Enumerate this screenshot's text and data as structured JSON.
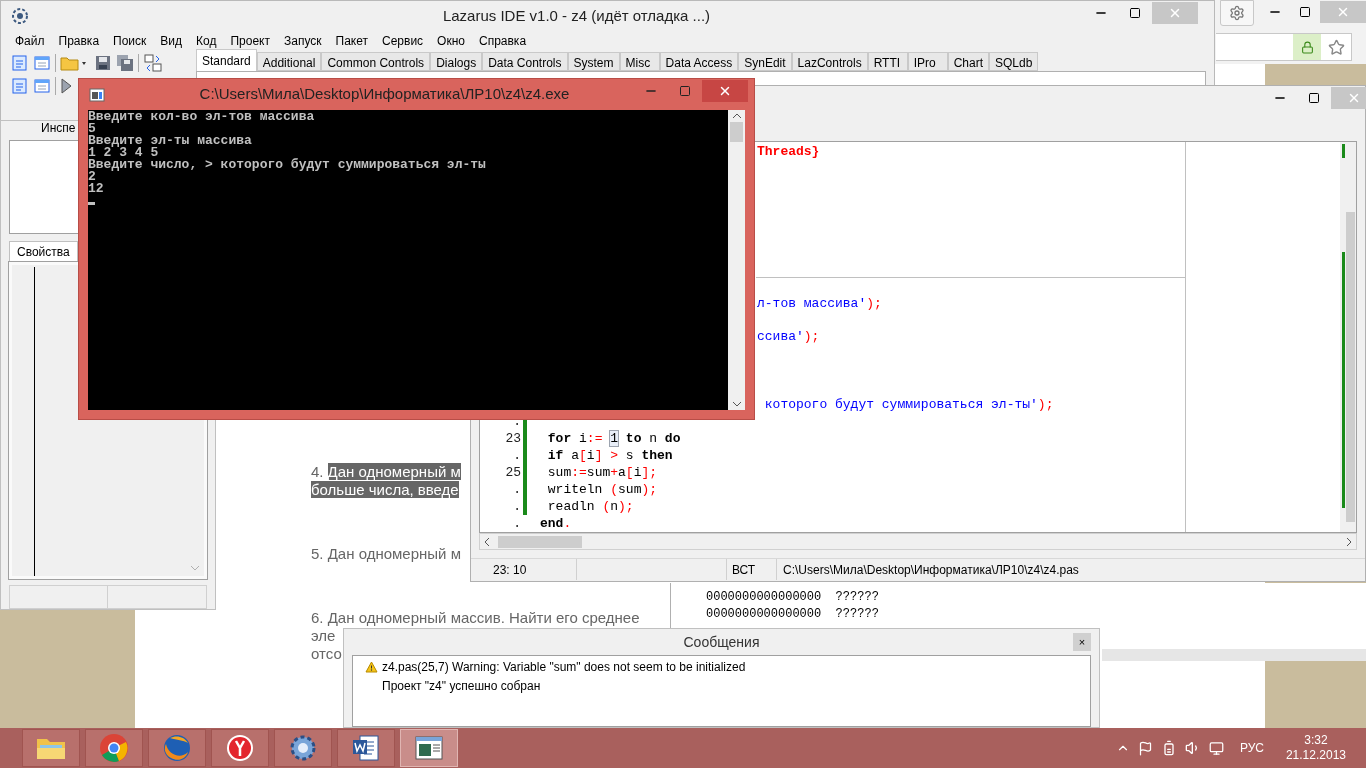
{
  "lazarus_window": {
    "title": "Lazarus IDE v1.0 - z4 (идёт отладка ...)",
    "menu": [
      "Файл",
      "Правка",
      "Поиск",
      "Вид",
      "Код",
      "Проект",
      "Запуск",
      "Пакет",
      "Сервис",
      "Окно",
      "Справка"
    ],
    "palette_tabs": [
      {
        "label": "Standard",
        "selected": true
      },
      {
        "label": "Additional",
        "selected": false
      },
      {
        "label": "Common Controls",
        "selected": false
      },
      {
        "label": "Dialogs",
        "selected": false
      },
      {
        "label": "Data Controls",
        "selected": false
      },
      {
        "label": "System",
        "selected": false
      },
      {
        "label": "Misc",
        "selected": false
      },
      {
        "label": "Data Access",
        "selected": false
      },
      {
        "label": "SynEdit",
        "selected": false
      },
      {
        "label": "LazControls",
        "selected": false
      },
      {
        "label": "RTTI",
        "selected": false
      },
      {
        "label": "IPro",
        "selected": false
      },
      {
        "label": "Chart",
        "selected": false
      },
      {
        "label": "SQLdb",
        "selected": false
      }
    ]
  },
  "object_inspector": {
    "title": "Инспе",
    "tabs": [
      {
        "label": "Свойства",
        "selected": true
      }
    ]
  },
  "browser_page": {
    "paragraphs": [
      {
        "lines": [
          [
            {
              "text": "4.",
              "highlighted": false
            },
            {
              "text": "Дан одномерный м",
              "highlighted": true
            }
          ],
          [
            {
              "text": "больше числа, введе",
              "highlighted": true
            }
          ]
        ]
      },
      {
        "lines": [
          [
            {
              "text": "5. Дан одномерный м",
              "highlighted": false
            }
          ]
        ]
      },
      {
        "lines": [
          [
            {
              "text": "6. Дан одномерный массив. Найти его среднее",
              "highlighted": false
            }
          ],
          [
            {
              "text": "эле",
              "highlighted": false
            }
          ],
          [
            {
              "text": "отсо",
              "highlighted": false
            }
          ]
        ]
      }
    ]
  },
  "source_editor": {
    "rows": [
      {
        "kind": "clipped",
        "tokens": [
          {
            "text": "Threads}",
            "kind": "dir"
          }
        ]
      },
      {
        "kind": "covered"
      },
      {
        "kind": "covered"
      },
      {
        "kind": "covered"
      },
      {
        "kind": "covered"
      },
      {
        "kind": "covered"
      },
      {
        "kind": "covered"
      },
      {
        "kind": "covered"
      },
      {
        "kind": "covered"
      },
      {
        "kind": "clipped",
        "tokens": [
          {
            "text": "л-тов массива'",
            "kind": "str"
          },
          {
            "text": ");",
            "kind": "sym"
          }
        ]
      },
      {
        "kind": "covered"
      },
      {
        "kind": "clipped",
        "tokens": [
          {
            "text": "ссива'",
            "kind": "str"
          },
          {
            "text": ");",
            "kind": "sym"
          }
        ]
      },
      {
        "kind": "covered"
      },
      {
        "kind": "covered"
      },
      {
        "kind": "covered"
      },
      {
        "kind": "clipped",
        "tokens": [
          {
            "text": " которого будут суммироваться эл-ты'",
            "kind": "str"
          },
          {
            "text": ");",
            "kind": "sym"
          }
        ]
      },
      {
        "kind": "gutter_only",
        "gutter": ".",
        "modified": true
      },
      {
        "kind": "full",
        "gutter": "23",
        "modified": true,
        "tokens": [
          {
            "text": " for",
            "kind": "kw"
          },
          {
            "text": " i",
            "kind": "id"
          },
          {
            "text": ":= ",
            "kind": "sym"
          },
          {
            "text": "1",
            "kind": "hl"
          },
          {
            "text": " to",
            "kind": "kw"
          },
          {
            "text": " n ",
            "kind": "id"
          },
          {
            "text": "do",
            "kind": "kw"
          }
        ]
      },
      {
        "kind": "full",
        "gutter": ".",
        "modified": true,
        "tokens": [
          {
            "text": " if",
            "kind": "kw"
          },
          {
            "text": " a",
            "kind": "id"
          },
          {
            "text": "[",
            "kind": "sym"
          },
          {
            "text": "i",
            "kind": "id"
          },
          {
            "text": "] >",
            "kind": "sym"
          },
          {
            "text": " s ",
            "kind": "id"
          },
          {
            "text": "then",
            "kind": "kw"
          }
        ]
      },
      {
        "kind": "full",
        "gutter": "25",
        "modified": true,
        "tokens": [
          {
            "text": " sum",
            "kind": "id"
          },
          {
            "text": ":=",
            "kind": "sym"
          },
          {
            "text": "sum",
            "kind": "id"
          },
          {
            "text": "+",
            "kind": "sym"
          },
          {
            "text": "a",
            "kind": "id"
          },
          {
            "text": "[",
            "kind": "sym"
          },
          {
            "text": "i",
            "kind": "id"
          },
          {
            "text": "];",
            "kind": "sym"
          }
        ]
      },
      {
        "kind": "full",
        "gutter": ".",
        "modified": true,
        "tokens": [
          {
            "text": " writeln ",
            "kind": "id"
          },
          {
            "text": "(",
            "kind": "sym"
          },
          {
            "text": "sum",
            "kind": "id"
          },
          {
            "text": ");",
            "kind": "sym"
          }
        ]
      },
      {
        "kind": "full",
        "gutter": ".",
        "modified": true,
        "tokens": [
          {
            "text": " readln ",
            "kind": "id"
          },
          {
            "text": "(",
            "kind": "sym"
          },
          {
            "text": "n",
            "kind": "id"
          },
          {
            "text": ");",
            "kind": "sym"
          }
        ]
      },
      {
        "kind": "full",
        "gutter": ".",
        "modified": false,
        "tokens": [
          {
            "text": "end",
            "kind": "kw"
          },
          {
            "text": ".",
            "kind": "sym"
          }
        ]
      }
    ],
    "status_bar": {
      "position": "23: 10",
      "mode": "ВСТ",
      "path": "C:\\Users\\Мила\\Desktop\\Информатика\\ЛР10\\z4\\z4.pas"
    }
  },
  "memory_window": {
    "lines": [
      "0000000000000000  ??????",
      "0000000000000000  ??????"
    ]
  },
  "console_window": {
    "title": "C:\\Users\\Мила\\Desktop\\Информатика\\ЛР10\\z4\\z4.exe",
    "lines": [
      "Введите кол-во эл-тов массива",
      "5",
      "Введите эл-ты массива",
      "1 2 3 4 5",
      "Введите число, > которого будут суммироваться эл-ты",
      "2",
      "12"
    ]
  },
  "messages_window": {
    "title": "Сообщения",
    "close": "×",
    "items": [
      {
        "kind": "warning",
        "text": "z4.pas(25,7) Warning: Variable \"sum\" does not seem to be initialized"
      },
      {
        "kind": "info",
        "text": "Проект \"z4\" успешно собран"
      }
    ]
  },
  "taskbar": {
    "apps": [
      {
        "kind": "folder",
        "selected": false
      },
      {
        "kind": "sphere",
        "selected": false
      },
      {
        "kind": "fox",
        "selected": false
      },
      {
        "kind": "circle",
        "selected": false
      },
      {
        "kind": "gear",
        "selected": false
      },
      {
        "kind": "doc",
        "selected": false
      },
      {
        "kind": "window",
        "selected": true
      }
    ],
    "language": "РУС",
    "time": "3:32",
    "date": "21.12.2013"
  }
}
